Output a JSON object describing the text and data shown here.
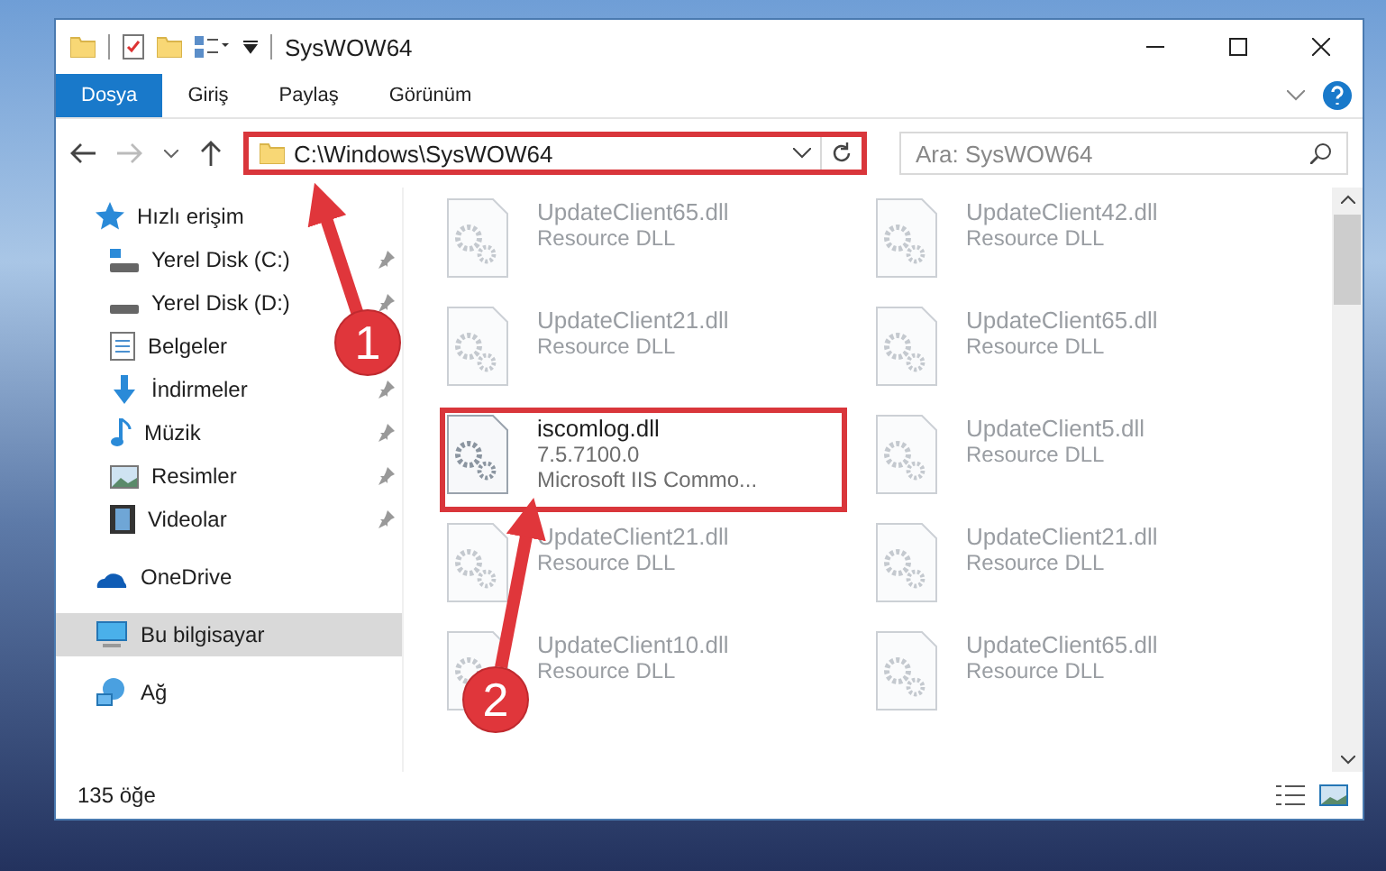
{
  "window": {
    "title": "SysWOW64"
  },
  "ribbon_tabs": [
    {
      "label": "Dosya",
      "selected": true
    },
    {
      "label": "Giriş",
      "selected": false
    },
    {
      "label": "Paylaş",
      "selected": false
    },
    {
      "label": "Görünüm",
      "selected": false
    }
  ],
  "address": {
    "path": "C:\\Windows\\SysWOW64",
    "highlighted": true
  },
  "search": {
    "placeholder": "Ara: SysWOW64"
  },
  "sidebar": [
    {
      "label": "Hızlı erişim",
      "kind": "quick",
      "selected": false,
      "children": [
        {
          "label": "Yerel Disk (C:)",
          "kind": "system-drive",
          "pinned": true
        },
        {
          "label": "Yerel Disk (D:)",
          "kind": "drive",
          "pinned": true
        },
        {
          "label": "Belgeler",
          "kind": "documents",
          "pinned": false
        },
        {
          "label": "İndirmeler",
          "kind": "downloads",
          "pinned": true
        },
        {
          "label": "Müzik",
          "kind": "music",
          "pinned": true
        },
        {
          "label": "Resimler",
          "kind": "pictures",
          "pinned": true
        },
        {
          "label": "Videolar",
          "kind": "videos",
          "pinned": true
        }
      ]
    },
    {
      "label": "OneDrive",
      "kind": "cloud",
      "selected": false
    },
    {
      "label": "Bu bilgisayar",
      "kind": "computer",
      "selected": true
    },
    {
      "label": "Ağ",
      "kind": "network",
      "selected": false
    }
  ],
  "files": [
    {
      "name": "UpdateClient65.dll",
      "details": [
        "Resource DLL"
      ],
      "faded": true,
      "highlighted": false
    },
    {
      "name": "UpdateClient42.dll",
      "details": [
        "Resource DLL"
      ],
      "faded": true,
      "highlighted": false
    },
    {
      "name": "UpdateClient21.dll",
      "details": [
        "Resource DLL"
      ],
      "faded": true,
      "highlighted": false
    },
    {
      "name": "UpdateClient65.dll",
      "details": [
        "Resource DLL"
      ],
      "faded": true,
      "highlighted": false
    },
    {
      "name": "iscomlog.dll",
      "details": [
        "7.5.7100.0",
        "Microsoft IIS Commo..."
      ],
      "faded": false,
      "highlighted": true
    },
    {
      "name": "UpdateClient5.dll",
      "details": [
        "Resource DLL"
      ],
      "faded": true,
      "highlighted": false
    },
    {
      "name": "UpdateClient21.dll",
      "details": [
        "Resource DLL"
      ],
      "faded": true,
      "highlighted": false
    },
    {
      "name": "UpdateClient21.dll",
      "details": [
        "Resource DLL"
      ],
      "faded": true,
      "highlighted": false
    },
    {
      "name": "UpdateClient10.dll",
      "details": [
        "Resource DLL"
      ],
      "faded": true,
      "highlighted": false
    },
    {
      "name": "UpdateClient65.dll",
      "details": [
        "Resource DLL"
      ],
      "faded": true,
      "highlighted": false
    }
  ],
  "status_bar": {
    "item_count": "135 öğe"
  },
  "annotations": [
    {
      "label": "1"
    },
    {
      "label": "2"
    }
  ]
}
